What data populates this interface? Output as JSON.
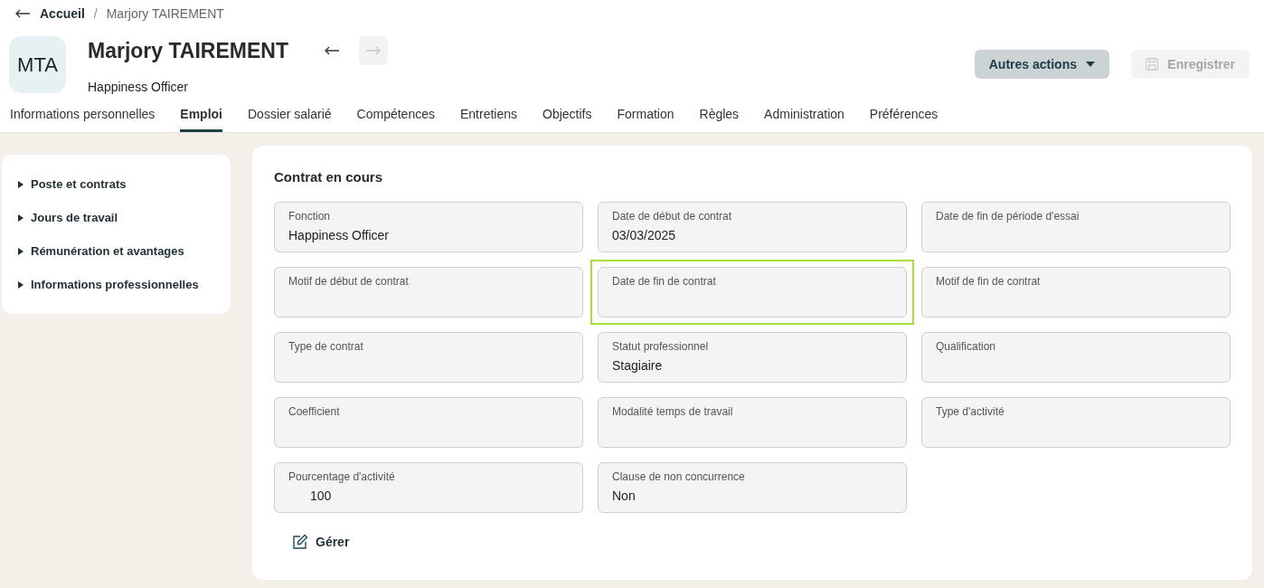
{
  "breadcrumb": {
    "items": [
      "Accueil",
      "Marjory TAIREMENT"
    ],
    "separator": "/"
  },
  "profile": {
    "initials": "MTA",
    "name": "Marjory TAIREMENT",
    "job_title": "Happiness Officer",
    "nav": [
      {
        "kind": "back",
        "disabled": false
      },
      {
        "kind": "forward",
        "disabled": true
      }
    ]
  },
  "actions": [
    {
      "kind": "menu",
      "label": "Autres actions",
      "disabled": false
    },
    {
      "kind": "save",
      "label": "Enregistrer",
      "disabled": true
    }
  ],
  "tabs": [
    {
      "label": "Informations personnelles",
      "selected": false
    },
    {
      "label": "Emploi",
      "selected": true
    },
    {
      "label": "Dossier salarié",
      "selected": false
    },
    {
      "label": "Compétences",
      "selected": false
    },
    {
      "label": "Entretiens",
      "selected": false
    },
    {
      "label": "Objectifs",
      "selected": false
    },
    {
      "label": "Formation",
      "selected": false
    },
    {
      "label": "Règles",
      "selected": false
    },
    {
      "label": "Administration",
      "selected": false
    },
    {
      "label": "Préférences",
      "selected": false
    }
  ],
  "sidebar": {
    "items": [
      "Poste et contrats",
      "Jours de travail",
      "Rémunération et avantages",
      "Informations professionnelles"
    ]
  },
  "section": {
    "title": "Contrat en cours",
    "fields": [
      {
        "kind": "text",
        "label": "Fonction",
        "value": "Happiness Officer",
        "focused": false
      },
      {
        "kind": "text",
        "label": "Date de début de contrat",
        "value": "03/03/2025",
        "focused": false
      },
      {
        "kind": "text",
        "label": "Date de fin de période d'essai",
        "focused": false
      },
      {
        "kind": "text",
        "label": "Motif de début de contrat",
        "focused": false
      },
      {
        "kind": "text",
        "label": "Date de fin de contrat",
        "focused": true
      },
      {
        "kind": "text",
        "label": "Motif de fin de contrat",
        "focused": false
      },
      {
        "kind": "text",
        "label": "Type de contrat",
        "focused": false
      },
      {
        "kind": "text",
        "label": "Statut professionnel",
        "value": "Stagiaire",
        "focused": false
      },
      {
        "kind": "text",
        "label": "Qualification",
        "focused": false
      },
      {
        "kind": "text",
        "label": "Coefficient",
        "focused": false
      },
      {
        "kind": "text",
        "label": "Modalité temps de travail",
        "focused": false
      },
      {
        "kind": "text",
        "label": "Type d'activité",
        "focused": false
      },
      {
        "kind": "number",
        "label": "Pourcentage d'activité",
        "value": "100",
        "focused": false
      },
      {
        "kind": "text",
        "label": "Clause de non concurrence",
        "value": "Non",
        "focused": false
      }
    ],
    "manage_link": "Gérer"
  }
}
